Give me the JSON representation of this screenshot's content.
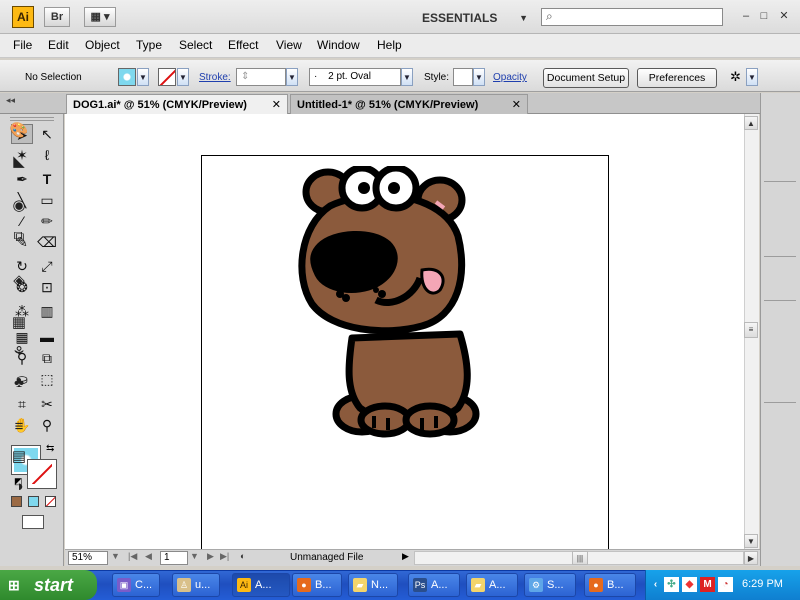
{
  "app": {
    "logo": "Ai",
    "bridge": "Br"
  },
  "titlebar": {
    "workspace": "ESSENTIALS",
    "search_placeholder": ""
  },
  "menu": [
    "File",
    "Edit",
    "Object",
    "Type",
    "Select",
    "Effect",
    "View",
    "Window",
    "Help"
  ],
  "control": {
    "selection": "No Selection",
    "stroke_label": "Stroke:",
    "brush": "2 pt. Oval",
    "brush_bullet": "·",
    "style_label": "Style:",
    "opacity_label": "Opacity",
    "doc_setup": "Document Setup",
    "preferences": "Preferences"
  },
  "tabs": [
    {
      "label": "DOG1.ai* @ 51% (CMYK/Preview)",
      "close": "✕"
    },
    {
      "label": "Untitled-1* @ 51% (CMYK/Preview)",
      "close": "✕"
    }
  ],
  "status": {
    "zoom": "51%",
    "page": "1",
    "info": "Unmanaged File"
  },
  "taskbar": {
    "start": "start",
    "items": [
      {
        "label": "C...",
        "icon": "app-icon"
      },
      {
        "label": "u...",
        "icon": "app-icon"
      },
      {
        "label": "A...",
        "icon": "illustrator-icon"
      },
      {
        "label": "B...",
        "icon": "firefox-icon"
      },
      {
        "label": "N...",
        "icon": "folder-icon"
      },
      {
        "label": "A...",
        "icon": "photoshop-icon"
      },
      {
        "label": "A...",
        "icon": "folder-icon"
      },
      {
        "label": "S...",
        "icon": "settings-icon"
      },
      {
        "label": "B...",
        "icon": "firefox-icon"
      }
    ],
    "clock": "6:29 PM"
  },
  "colors": {
    "fill": "#7fd8ee",
    "dog_fur": "#8b5a3c",
    "tongue": "#f4a6b6"
  }
}
